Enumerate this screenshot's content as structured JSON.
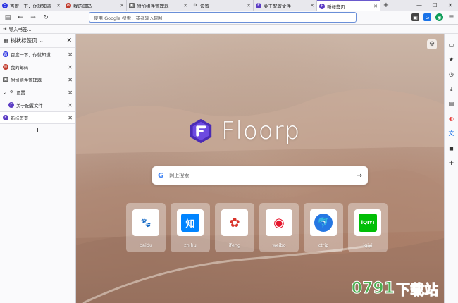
{
  "tabs": [
    {
      "label": "百度一下，你就知道",
      "icon": "baidu-icon",
      "color": "#2932e1"
    },
    {
      "label": "我的邮码",
      "icon": "mail-icon",
      "color": "#c0392b"
    },
    {
      "label": "附加组件管理器",
      "icon": "puzzle-icon",
      "color": "#555555"
    },
    {
      "label": "设置",
      "icon": "gear-icon",
      "color": "#555555"
    },
    {
      "label": "关于配置文件",
      "icon": "floorp-icon",
      "color": "#5b3cc4"
    },
    {
      "label": "新标签页",
      "icon": "floorp-icon",
      "color": "#5b3cc4",
      "active": true
    }
  ],
  "navbar": {
    "url_placeholder": "使用 Google 搜索，或者输入网址"
  },
  "bookmarks": {
    "import_label": "导入书签..."
  },
  "sidebar": {
    "title": "树状标签页",
    "items": [
      {
        "label": "百度一下，你就知道",
        "icon": "baidu-icon",
        "color": "#2932e1"
      },
      {
        "label": "我的邮码",
        "icon": "mail-icon",
        "color": "#c0392b"
      },
      {
        "label": "附加组件管理器",
        "icon": "puzzle-icon",
        "color": "#555555"
      },
      {
        "label": "设置",
        "icon": "gear-icon",
        "color": "#555555"
      },
      {
        "label": "关于配置文件",
        "icon": "floorp-icon",
        "color": "#5b3cc4"
      },
      {
        "label": "新标签页",
        "icon": "floorp-icon",
        "color": "#5b3cc4"
      }
    ]
  },
  "newtab": {
    "brand": "Floorp",
    "search_placeholder": "网上搜索",
    "shortcuts": [
      {
        "label": "baidu",
        "color": "#2932e1",
        "glyph": "du"
      },
      {
        "label": "zhihu",
        "color": "#0084ff",
        "glyph": "知"
      },
      {
        "label": "ifeng",
        "color": "#d9342b",
        "glyph": "凤"
      },
      {
        "label": "weibo",
        "color": "#e6162d",
        "glyph": "微"
      },
      {
        "label": "ctrip",
        "color": "#2577e3",
        "glyph": "携"
      },
      {
        "label": "iqiyi",
        "color": "#00be06",
        "glyph": "iQIYI"
      }
    ]
  },
  "watermark": {
    "digits": "0791",
    "text": "下载站"
  }
}
